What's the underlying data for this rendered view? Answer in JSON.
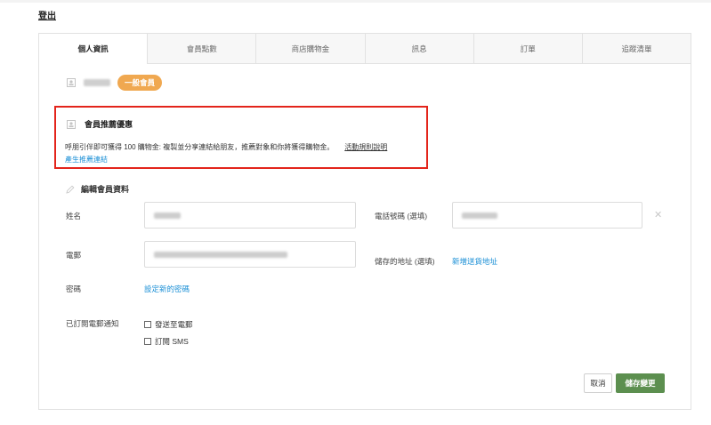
{
  "header": {
    "logout_label": "登出"
  },
  "tabs": [
    {
      "label": "個人資訊",
      "active": true
    },
    {
      "label": "會員點數",
      "active": false
    },
    {
      "label": "商店購物金",
      "active": false
    },
    {
      "label": "訊息",
      "active": false
    },
    {
      "label": "訂單",
      "active": false
    },
    {
      "label": "追蹤清單",
      "active": false
    }
  ],
  "member": {
    "tier_badge": "一般會員"
  },
  "referral": {
    "title": "會員推薦優惠",
    "description": "呼朋引伴即可獲得 100 購物金: 複製並分享連結給朋友，推薦對象和你將獲得購物金。",
    "rules_link": "活動規則說明",
    "generate_link": "產生推薦連結"
  },
  "edit": {
    "title": "編輯會員資料",
    "name_label": "姓名",
    "phone_label": "電話號碼 (選填)",
    "email_label": "電郵",
    "address_label": "儲存的地址 (選填)",
    "address_link": "新增送貨地址",
    "password_label": "密碼",
    "password_link": "設定新的密碼",
    "subscription_label": "已訂閱電郵通知",
    "option_email": "發送至電郵",
    "option_sms": "訂閱 SMS"
  },
  "actions": {
    "cancel": "取消",
    "save": "儲存變更"
  },
  "colors": {
    "badge": "#f0a850",
    "highlight_border": "#e3241b",
    "link": "#1a8fd6",
    "save_button": "#5c8f4f"
  }
}
